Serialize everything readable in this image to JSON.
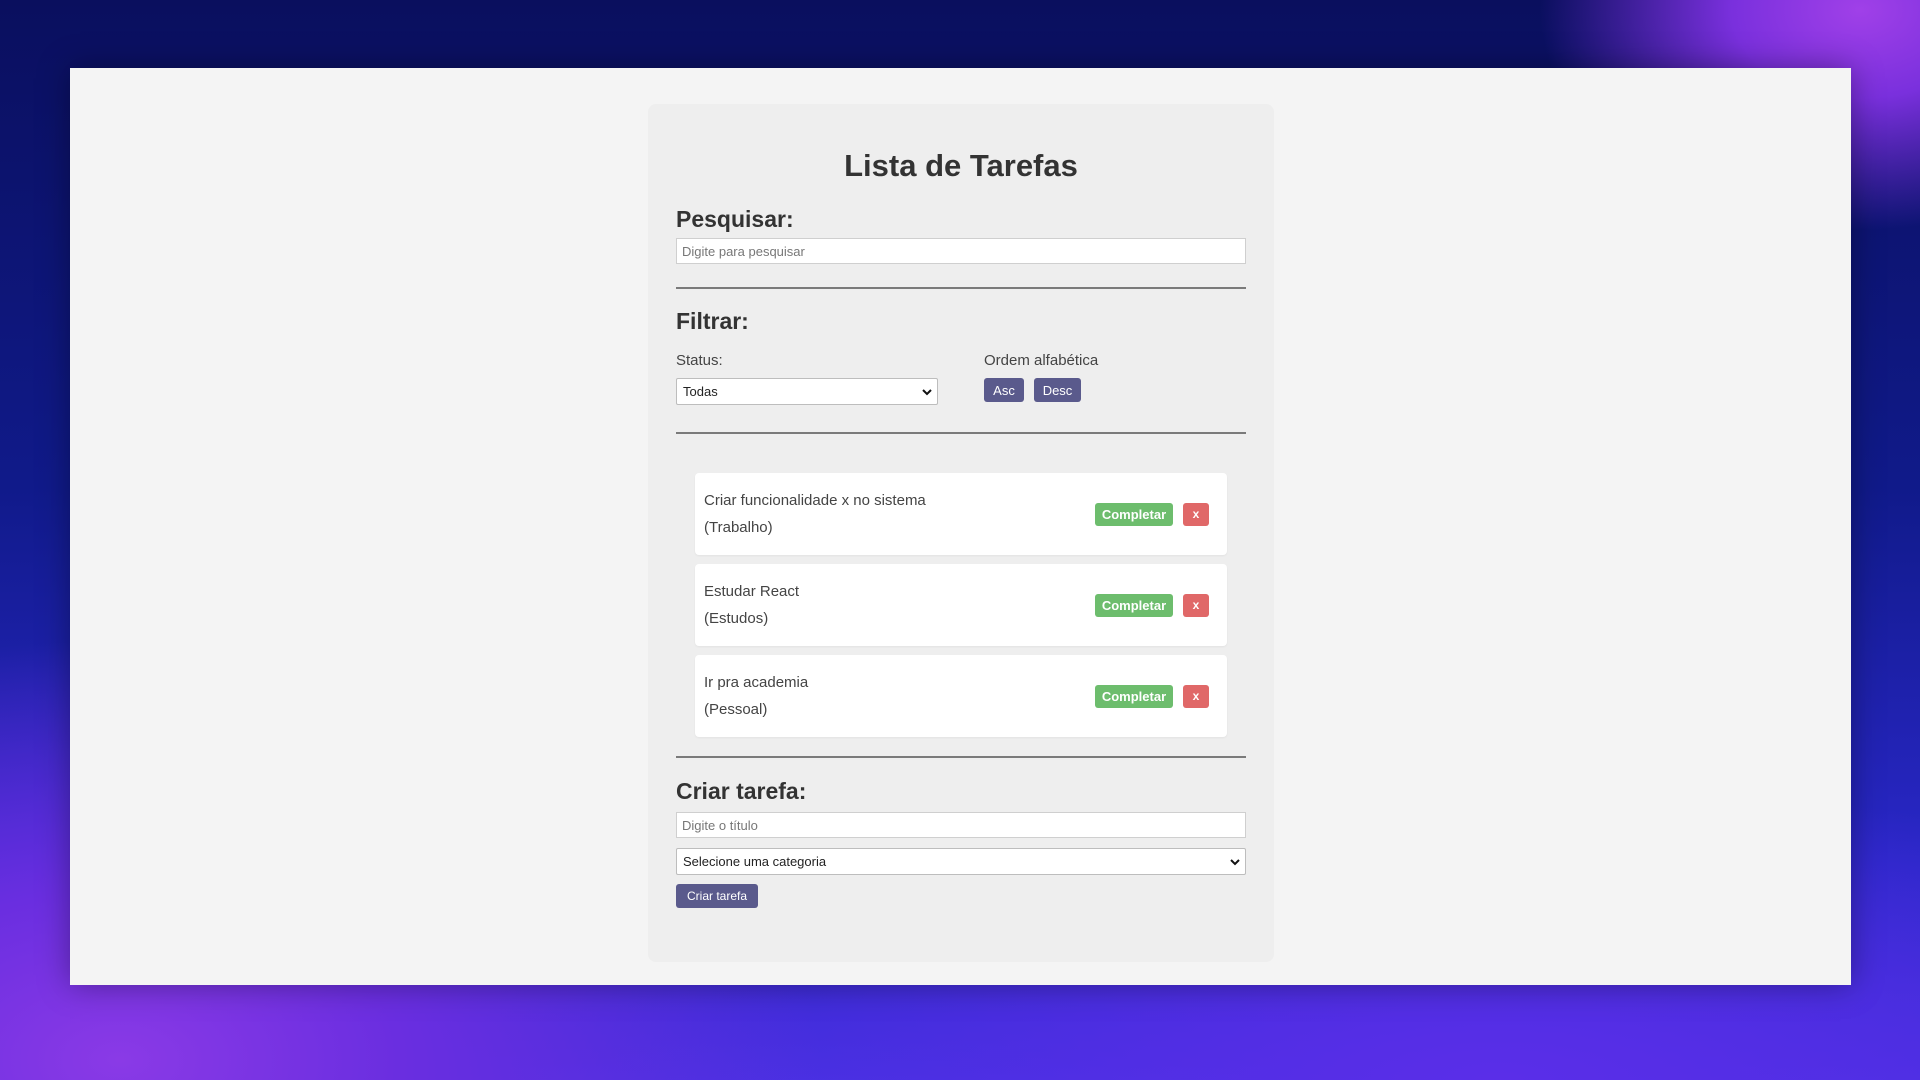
{
  "page": {
    "title": "Lista de Tarefas"
  },
  "search": {
    "heading": "Pesquisar:",
    "placeholder": "Digite para pesquisar",
    "value": ""
  },
  "filter": {
    "heading": "Filtrar:",
    "status_label": "Status:",
    "status_selected": "Todas",
    "order_label": "Ordem alfabética",
    "asc_label": "Asc",
    "desc_label": "Desc"
  },
  "tasks": [
    {
      "title": "Criar funcionalidade x no sistema",
      "category": "(Trabalho)",
      "complete_label": "Completar",
      "remove_label": "x"
    },
    {
      "title": "Estudar React",
      "category": "(Estudos)",
      "complete_label": "Completar",
      "remove_label": "x"
    },
    {
      "title": "Ir pra academia",
      "category": "(Pessoal)",
      "complete_label": "Completar",
      "remove_label": "x"
    }
  ],
  "create": {
    "heading": "Criar tarefa:",
    "title_placeholder": "Digite o título",
    "category_selected": "Selecione uma categoria",
    "submit_label": "Criar tarefa"
  },
  "colors": {
    "accent": "#5a5a8c",
    "complete": "#6dbd6d",
    "remove": "#e06868"
  }
}
